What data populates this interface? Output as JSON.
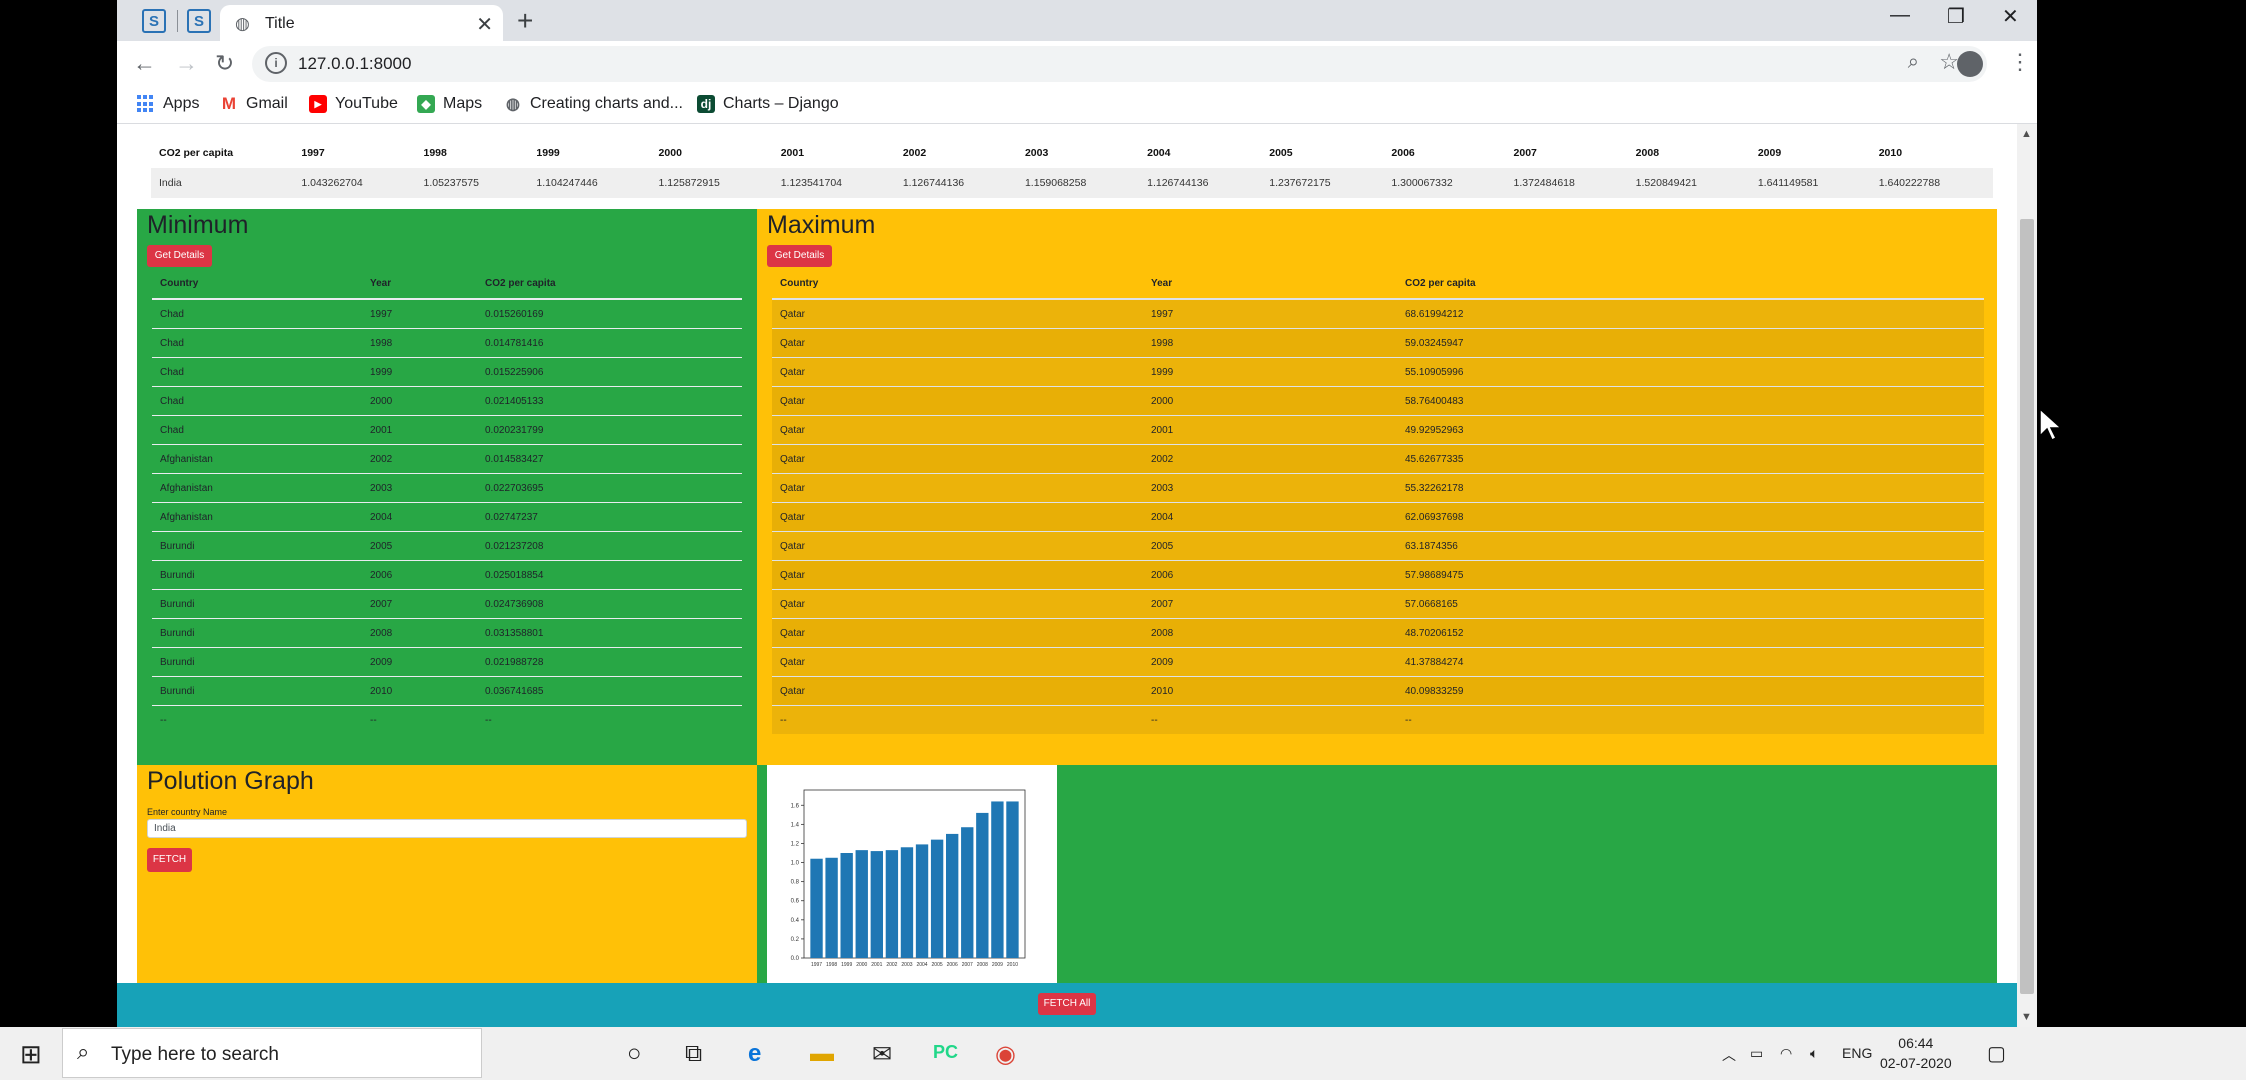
{
  "browser": {
    "tab_title": "Title",
    "url": "127.0.0.1:8000",
    "pinned_tabs": [
      "S",
      "S"
    ],
    "bookmarks": [
      "Apps",
      "Gmail",
      "YouTube",
      "Maps",
      "Creating charts and...",
      "Charts – Django"
    ]
  },
  "top_table": {
    "headers": [
      "CO2 per capita",
      "1997",
      "1998",
      "1999",
      "2000",
      "2001",
      "2002",
      "2003",
      "2004",
      "2005",
      "2006",
      "2007",
      "2008",
      "2009",
      "2010"
    ],
    "row": [
      "India",
      "1.043262704",
      "1.05237575",
      "1.104247446",
      "1.125872915",
      "1.123541704",
      "1.126744136",
      "1.159068258",
      "1.126744136",
      "1.237672175",
      "1.300067332",
      "1.372484618",
      "1.520849421",
      "1.641149581",
      "1.640222788"
    ]
  },
  "minimum": {
    "title": "Minimum",
    "button": "Get Details",
    "headers": [
      "Country",
      "Year",
      "CO2 per capita"
    ],
    "rows": [
      [
        "Chad",
        "1997",
        "0.015260169"
      ],
      [
        "Chad",
        "1998",
        "0.014781416"
      ],
      [
        "Chad",
        "1999",
        "0.015225906"
      ],
      [
        "Chad",
        "2000",
        "0.021405133"
      ],
      [
        "Chad",
        "2001",
        "0.020231799"
      ],
      [
        "Afghanistan",
        "2002",
        "0.014583427"
      ],
      [
        "Afghanistan",
        "2003",
        "0.022703695"
      ],
      [
        "Afghanistan",
        "2004",
        "0.02747237"
      ],
      [
        "Burundi",
        "2005",
        "0.021237208"
      ],
      [
        "Burundi",
        "2006",
        "0.025018854"
      ],
      [
        "Burundi",
        "2007",
        "0.024736908"
      ],
      [
        "Burundi",
        "2008",
        "0.031358801"
      ],
      [
        "Burundi",
        "2009",
        "0.021988728"
      ],
      [
        "Burundi",
        "2010",
        "0.036741685"
      ],
      [
        "--",
        "--",
        "--"
      ]
    ]
  },
  "maximum": {
    "title": "Maximum",
    "button": "Get Details",
    "headers": [
      "Country",
      "Year",
      "CO2 per capita"
    ],
    "rows": [
      [
        "Qatar",
        "1997",
        "68.61994212"
      ],
      [
        "Qatar",
        "1998",
        "59.03245947"
      ],
      [
        "Qatar",
        "1999",
        "55.10905996"
      ],
      [
        "Qatar",
        "2000",
        "58.76400483"
      ],
      [
        "Qatar",
        "2001",
        "49.92952963"
      ],
      [
        "Qatar",
        "2002",
        "45.62677335"
      ],
      [
        "Qatar",
        "2003",
        "55.32262178"
      ],
      [
        "Qatar",
        "2004",
        "62.06937698"
      ],
      [
        "Qatar",
        "2005",
        "63.1874356"
      ],
      [
        "Qatar",
        "2006",
        "57.98689475"
      ],
      [
        "Qatar",
        "2007",
        "57.0668165"
      ],
      [
        "Qatar",
        "2008",
        "48.70206152"
      ],
      [
        "Qatar",
        "2009",
        "41.37884274"
      ],
      [
        "Qatar",
        "2010",
        "40.09833259"
      ],
      [
        "--",
        "--",
        "--"
      ]
    ]
  },
  "graph": {
    "title": "Polution Graph",
    "input_label": "Enter country Name",
    "input_value": "India",
    "fetch_button": "FETCH"
  },
  "footer": {
    "fetch_all_button": "FETCH All"
  },
  "chart_data": {
    "type": "bar",
    "categories": [
      "1997",
      "1998",
      "1999",
      "2000",
      "2001",
      "2002",
      "2003",
      "2004",
      "2005",
      "2006",
      "2007",
      "2008",
      "2009",
      "2010"
    ],
    "values": [
      1.04,
      1.05,
      1.1,
      1.13,
      1.12,
      1.13,
      1.16,
      1.19,
      1.24,
      1.3,
      1.37,
      1.52,
      1.64,
      1.64
    ],
    "yticks": [
      "0.0",
      "0.2",
      "0.4",
      "0.6",
      "0.8",
      "1.0",
      "1.2",
      "1.4",
      "1.6"
    ],
    "ylim": [
      0,
      1.76
    ],
    "color": "#1f77b4"
  },
  "taskbar": {
    "search_placeholder": "Type here to search",
    "language": "ENG",
    "time": "06:44",
    "date": "02-07-2020"
  }
}
